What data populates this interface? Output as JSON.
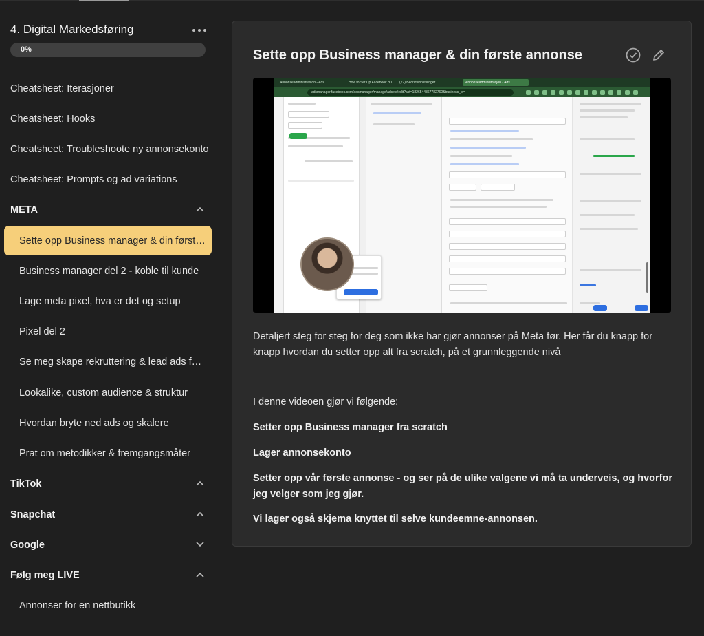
{
  "course": {
    "title": "4. Digital Markedsføring",
    "progress_label": "0%",
    "progress_value": 0
  },
  "sidebar": {
    "top_items": [
      "Cheatsheet: Iterasjoner",
      "Cheatsheet: Hooks",
      "Cheatsheet: Troubleshoote ny annonsekonto",
      "Cheatsheet: Prompts og ad variations"
    ],
    "sections": {
      "meta": {
        "label": "META",
        "items": [
          "Sette opp Business manager & din første annonse",
          "Business manager del 2 - koble til kunde",
          "Lage meta pixel, hva er det og setup",
          "Pixel del 2",
          "Se meg skape rekruttering & lead ads for kunde",
          "Lookalike, custom audience & struktur",
          "Hvordan bryte ned ads og skalere",
          "Prat om metodikker & fremgangsmåter"
        ]
      },
      "tiktok": {
        "label": "TikTok"
      },
      "snapchat": {
        "label": "Snapchat"
      },
      "google": {
        "label": "Google"
      },
      "live": {
        "label": "Følg meg LIVE",
        "items": [
          "Annonser for en nettbutikk"
        ]
      }
    }
  },
  "lesson": {
    "title": "Sette opp Business manager & din første annonse",
    "description": "Detaljert steg for steg for deg som ikke har gjør annonser på Meta før. Her får du knapp for knapp hvordan du setter opp alt fra scratch, på et grunnleggende nivå",
    "intro": "I denne videoen gjør vi følgende:",
    "steps": [
      "Setter opp Business manager fra scratch",
      "Lager annonsekonto",
      "Setter opp vår første annonse - og ser på de ulike valgene vi må ta underveis, og hvorfor jeg velger som jeg gjør.",
      "Vi lager også skjema knyttet til selve kundeemne-annonsen."
    ]
  },
  "video": {
    "tabs": [
      "Annonseadministrasjon - Ads",
      "How to Set Up Facebook Bu",
      "(22) Bedriftsinnstillinger",
      "Annonseadministrasjon - Ads"
    ],
    "url": "adsmanager.facebook.com/adsmanager/manage/adsets/edit?act=1826544367782760&business_id="
  },
  "colors": {
    "background": "#1f1f1f",
    "card": "#2b2b2b",
    "active_item": "#f6cf7a",
    "browser_chrome": "#2b5a33"
  }
}
